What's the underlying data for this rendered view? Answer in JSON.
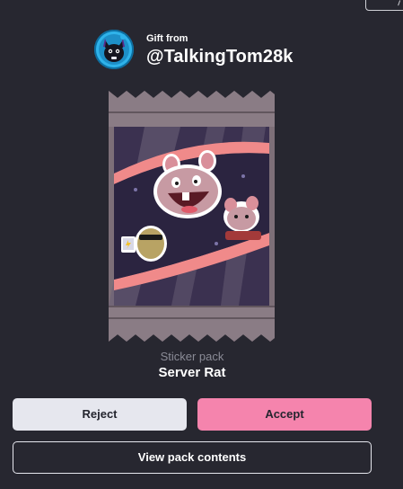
{
  "gift": {
    "from_label": "Gift from",
    "sender_username": "@TalkingTom28k"
  },
  "pack": {
    "type_label": "Sticker pack",
    "name": "Server Rat"
  },
  "actions": {
    "reject_label": "Reject",
    "accept_label": "Accept",
    "view_contents_label": "View pack contents"
  },
  "colors": {
    "background": "#272730",
    "accept": "#f584ad",
    "reject": "#e6e7ee",
    "avatar_ring": "#1b9ad6"
  },
  "icons": {
    "avatar": "black-cat-avatar-icon",
    "pack_art": "sticker-pack-wrapper-image"
  }
}
